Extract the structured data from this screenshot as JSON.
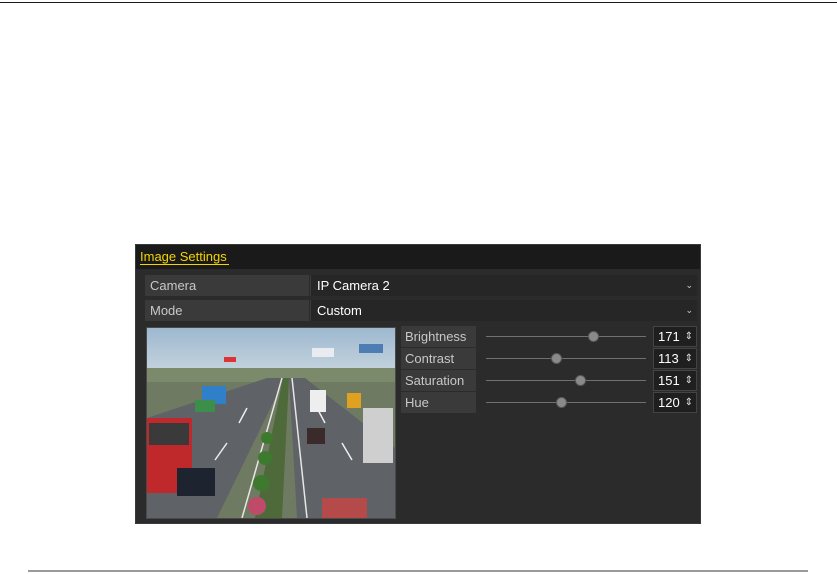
{
  "panel": {
    "title": "Image Settings"
  },
  "fields": {
    "camera": {
      "label": "Camera",
      "value": "IP Camera 2"
    },
    "mode": {
      "label": "Mode",
      "value": "Custom"
    }
  },
  "adjustments": [
    {
      "label": "Brightness",
      "value": "171",
      "level": 171
    },
    {
      "label": "Contrast",
      "value": "113",
      "level": 113
    },
    {
      "label": "Saturation",
      "value": "151",
      "level": 151
    },
    {
      "label": "Hue",
      "value": "120",
      "level": 120
    }
  ],
  "icons": {
    "dropdown": "chevron-down-icon",
    "spinner": "spinner-arrows-icon"
  },
  "colors": {
    "panel_bg": "#2b2b2b",
    "title_accent": "#f5d400"
  }
}
